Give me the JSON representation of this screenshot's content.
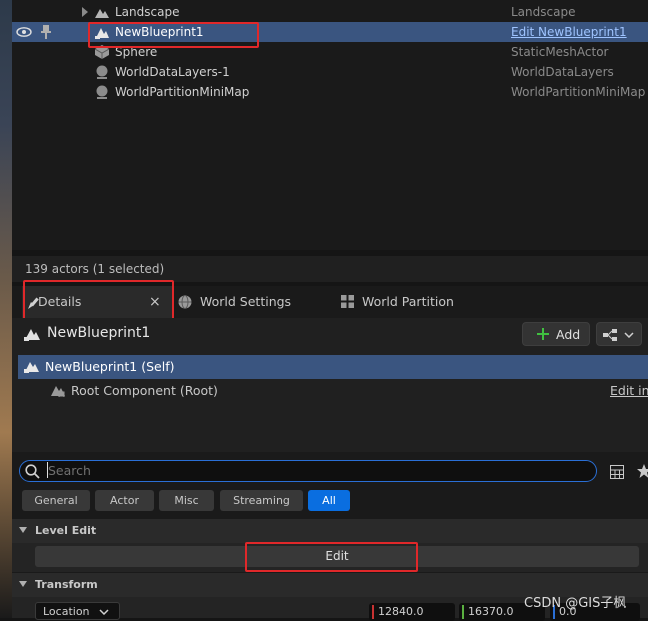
{
  "outliner": {
    "rows": [
      {
        "name": "Landscape",
        "type": "Landscape"
      },
      {
        "name": "NewBlueprint1",
        "type": "Edit NewBlueprint1"
      },
      {
        "name": "Sphere",
        "type": "StaticMeshActor"
      },
      {
        "name": "WorldDataLayers-1",
        "type": "WorldDataLayers"
      },
      {
        "name": "WorldPartitionMiniMap",
        "type": "WorldPartitionMiniMap"
      }
    ],
    "status": "139 actors (1 selected)"
  },
  "tabs": {
    "details": "Details",
    "close": "×",
    "world_settings": "World Settings",
    "world_partition": "World Partition"
  },
  "details": {
    "actor_name": "NewBlueprint1",
    "add_label": "Add",
    "components": [
      {
        "label": "NewBlueprint1 (Self)"
      },
      {
        "label": "Root Component (Root)",
        "action": "Edit in"
      }
    ],
    "search_placeholder": "Search",
    "categories": [
      "General",
      "Actor",
      "Misc",
      "Streaming",
      "All"
    ],
    "level_edit": {
      "title": "Level Edit",
      "edit_label": "Edit"
    },
    "transform": {
      "title": "Transform",
      "location_label": "Location",
      "location": [
        "12840.0",
        "16370.0",
        "0.0"
      ]
    }
  },
  "watermark": "CSDN @GIS子枫",
  "colors": {
    "selection": "#3a5580",
    "accent_blue": "#0a6ee0",
    "highlight_red": "#e0282a",
    "add_green": "#40c040"
  }
}
